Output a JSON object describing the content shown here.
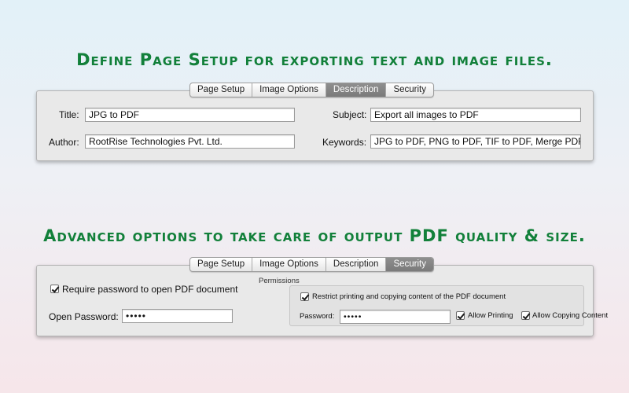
{
  "headlines": {
    "top": "Define Page Setup for exporting text and image files.",
    "bottom": "Advanced options to take care of output PDF quality & size."
  },
  "tabs": [
    "Page Setup",
    "Image Options",
    "Description",
    "Security"
  ],
  "description_panel": {
    "active_tab": "Description",
    "title_label": "Title:",
    "title_value": "JPG to PDF",
    "author_label": "Author:",
    "author_value": "RootRise Technologies Pvt. Ltd.",
    "subject_label": "Subject:",
    "subject_value": "Export all images to PDF",
    "keywords_label": "Keywords:",
    "keywords_value": "JPG to PDF, PNG to PDF, TIF to PDF, Merge PDF"
  },
  "security_panel": {
    "active_tab": "Security",
    "require_password_label": "Require password to open PDF document",
    "require_password_checked": true,
    "open_password_label": "Open Password:",
    "open_password_value": "•••••",
    "permissions_title": "Permissions",
    "restrict_label": "Restrict printing and copying content of the PDF document",
    "restrict_checked": true,
    "password_label": "Password:",
    "password_value": "•••••",
    "allow_printing_label": "Allow Printing",
    "allow_printing_checked": true,
    "allow_copying_label": "Allow Copying Content",
    "allow_copying_checked": true
  },
  "colors": {
    "headline": "#12803a",
    "active_tab": "#858585"
  }
}
